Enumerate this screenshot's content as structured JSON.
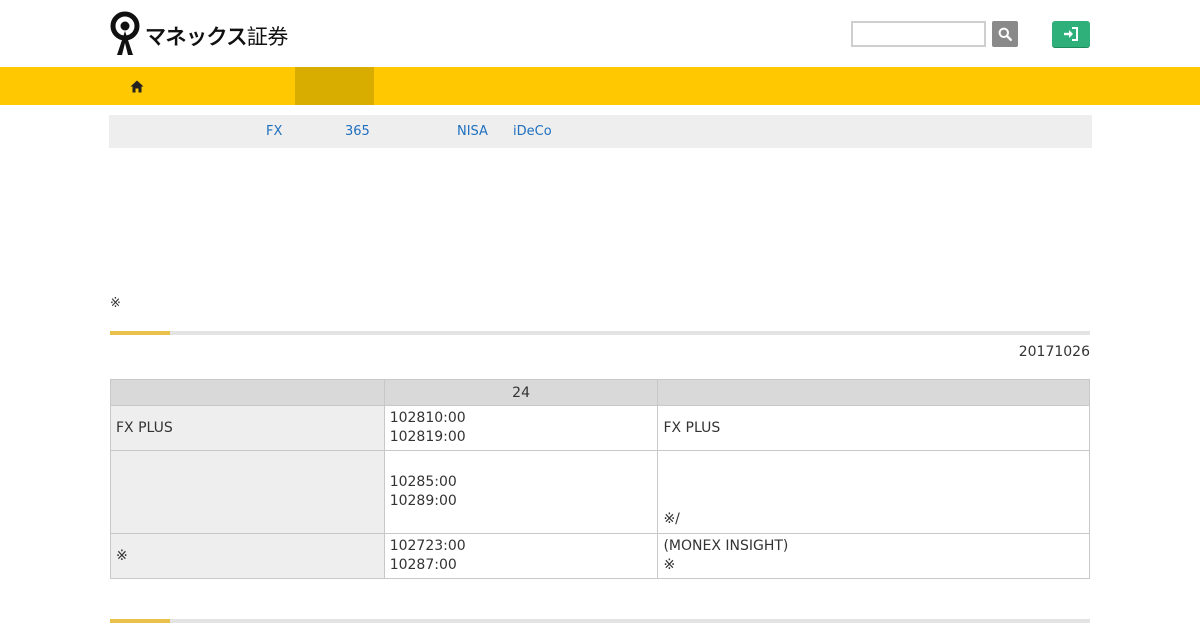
{
  "header": {
    "logo": {
      "name": "マネックス証券",
      "strong": "マネックス",
      "light": "証券"
    },
    "search": {
      "value": "",
      "placeholder": ""
    },
    "icons": {
      "search": "search-icon",
      "login": "sign-in-icon",
      "home": "home-icon"
    }
  },
  "colors": {
    "brand_yellow": "#ffc800",
    "nav_active": "#d9ad00",
    "login_green": "#2fb07a",
    "link_blue": "#1f6fbf"
  },
  "subnav": {
    "items": [
      {
        "label": "FX"
      },
      {
        "label": "365"
      },
      {
        "label": "NISA"
      },
      {
        "label": "iDeCo"
      }
    ]
  },
  "notice": {
    "mark": "※"
  },
  "section": {
    "date": "20171026"
  },
  "table": {
    "headers": [
      "",
      "24",
      ""
    ],
    "rows": [
      {
        "label": "FX PLUS",
        "times": [
          "102810:00",
          "102819:00"
        ],
        "note": [
          "FX PLUS"
        ]
      },
      {
        "label": "",
        "times": [
          "10285:00",
          "10289:00"
        ],
        "note": [
          "※/"
        ]
      },
      {
        "label": "※",
        "times": [
          "102723:00",
          "10287:00"
        ],
        "note": [
          "(MONEX INSIGHT)",
          "※"
        ]
      }
    ]
  }
}
